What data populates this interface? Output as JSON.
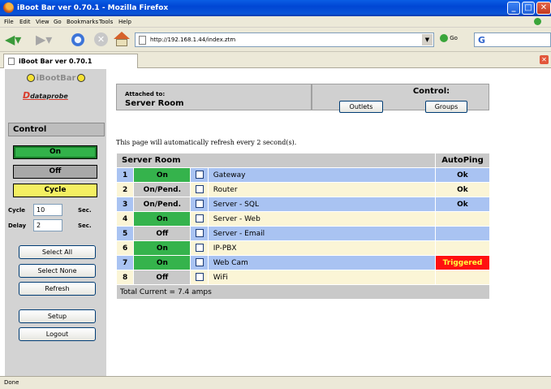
{
  "window": {
    "title": "iBoot Bar ver 0.70.1 - Mozilla Firefox"
  },
  "menu": [
    "File",
    "Edit",
    "View",
    "Go",
    "Bookmarks",
    "Tools",
    "Help"
  ],
  "address": {
    "url": "http://192.168.1.44/index.ztm",
    "go_label": "Go"
  },
  "tab": {
    "label": "iBoot Bar ver 0.70.1"
  },
  "status_bar": "Done",
  "sidebar": {
    "logo_top": "iBootBar",
    "logo_bottom": "dataprobe",
    "control_heading": "Control",
    "on_label": "On",
    "off_label": "Off",
    "cycle_label": "Cycle",
    "cycle_field_label": "Cycle",
    "cycle_value": "10",
    "delay_field_label": "Delay",
    "delay_value": "2",
    "unit": "Sec.",
    "select_all": "Select All",
    "select_none": "Select None",
    "refresh": "Refresh",
    "setup": "Setup",
    "logout": "Logout"
  },
  "header": {
    "attached_label": "Attached to:",
    "attached_value": "Server Room",
    "control_label": "Control:",
    "outlets_button": "Outlets",
    "groups_button": "Groups"
  },
  "refresh_note": "This page will automatically refresh every 2 second(s).",
  "table": {
    "title": "Server Room",
    "autoping_header": "AutoPing",
    "rows": [
      {
        "num": "1",
        "status": "On",
        "name": "Gateway",
        "autoping": "Ok"
      },
      {
        "num": "2",
        "status": "On/Pend.",
        "name": "Router",
        "autoping": "Ok"
      },
      {
        "num": "3",
        "status": "On/Pend.",
        "name": "Server - SQL",
        "autoping": "Ok"
      },
      {
        "num": "4",
        "status": "On",
        "name": "Server - Web",
        "autoping": ""
      },
      {
        "num": "5",
        "status": "Off",
        "name": "Server - Email",
        "autoping": ""
      },
      {
        "num": "6",
        "status": "On",
        "name": "IP-PBX",
        "autoping": ""
      },
      {
        "num": "7",
        "status": "On",
        "name": "Web Cam",
        "autoping": "Triggered"
      },
      {
        "num": "8",
        "status": "Off",
        "name": "WiFi",
        "autoping": ""
      }
    ],
    "total": "Total Current = 7.4 amps"
  },
  "colors": {
    "on": "#35b34c",
    "off_pend": "#c9c9c9",
    "row_blue": "#a9c3f2",
    "row_cream": "#fbf5d6",
    "triggered": "#ff1010",
    "cycle": "#f4ef62"
  }
}
